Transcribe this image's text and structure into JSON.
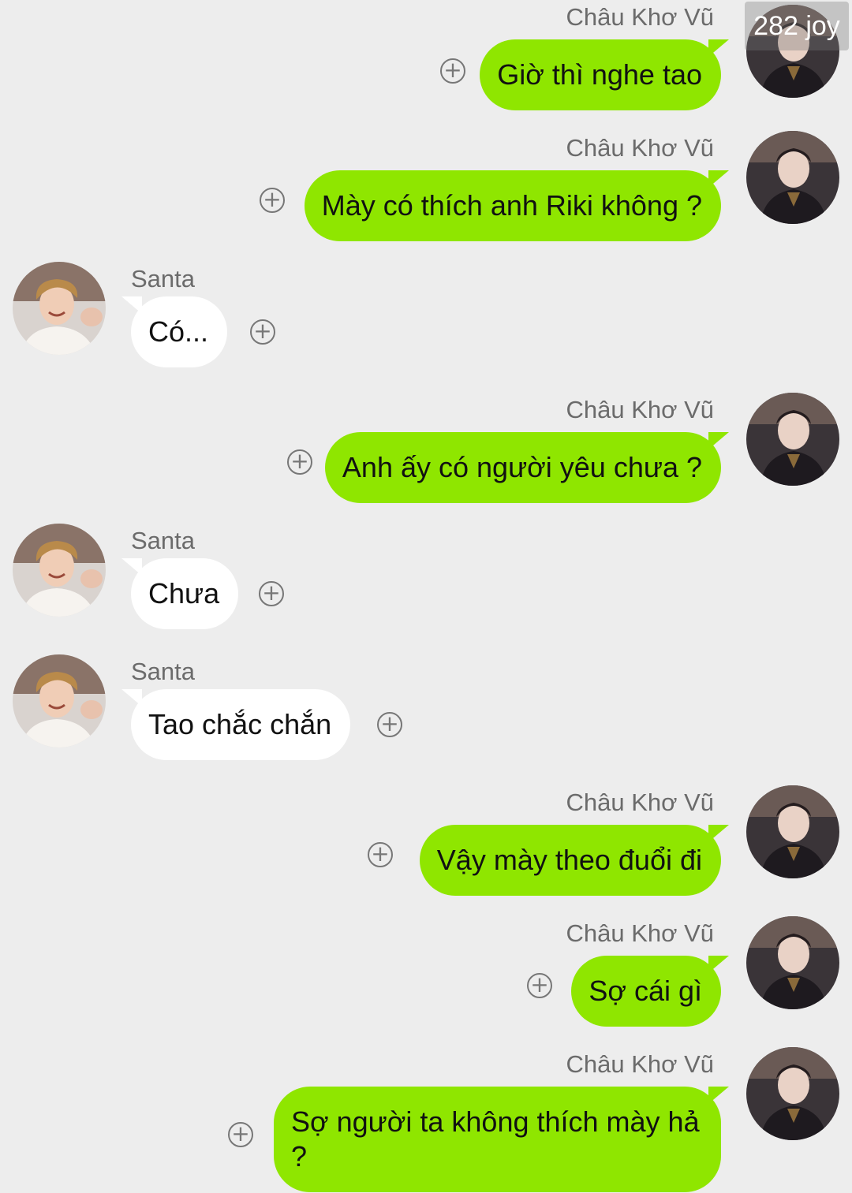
{
  "watermark": "282 joy",
  "messages": [
    {
      "side": "right",
      "sender": "Châu Khơ Vũ",
      "text": "Giờ thì nghe tao",
      "avatar": "chau-avatar"
    },
    {
      "side": "right",
      "sender": "Châu Khơ Vũ",
      "text": "Mày có thích anh Riki không ?",
      "avatar": "chau-avatar"
    },
    {
      "side": "left",
      "sender": "Santa",
      "text": "Có...",
      "avatar": "santa-avatar"
    },
    {
      "side": "right",
      "sender": "Châu Khơ Vũ",
      "text": "Anh ấy có người yêu chưa ?",
      "avatar": "chau-avatar"
    },
    {
      "side": "left",
      "sender": "Santa",
      "text": "Chưa",
      "avatar": "santa-avatar"
    },
    {
      "side": "left",
      "sender": "Santa",
      "text": "Tao chắc chắn",
      "avatar": "santa-avatar"
    },
    {
      "side": "right",
      "sender": "Châu Khơ Vũ",
      "text": "Vậy mày theo đuổi đi",
      "avatar": "chau-avatar"
    },
    {
      "side": "right",
      "sender": "Châu Khơ Vũ",
      "text": "Sợ cái gì",
      "avatar": "chau-avatar"
    },
    {
      "side": "right",
      "sender": "Châu Khơ Vũ",
      "text": "Sợ người ta không thích mày hả ?",
      "avatar": "chau-avatar"
    }
  ],
  "icons": {
    "add": "plus-circle-icon"
  },
  "colors": {
    "background": "#ededed",
    "outgoing_bubble": "#8fe600",
    "incoming_bubble": "#ffffff",
    "name_text": "#6b6b6b"
  }
}
